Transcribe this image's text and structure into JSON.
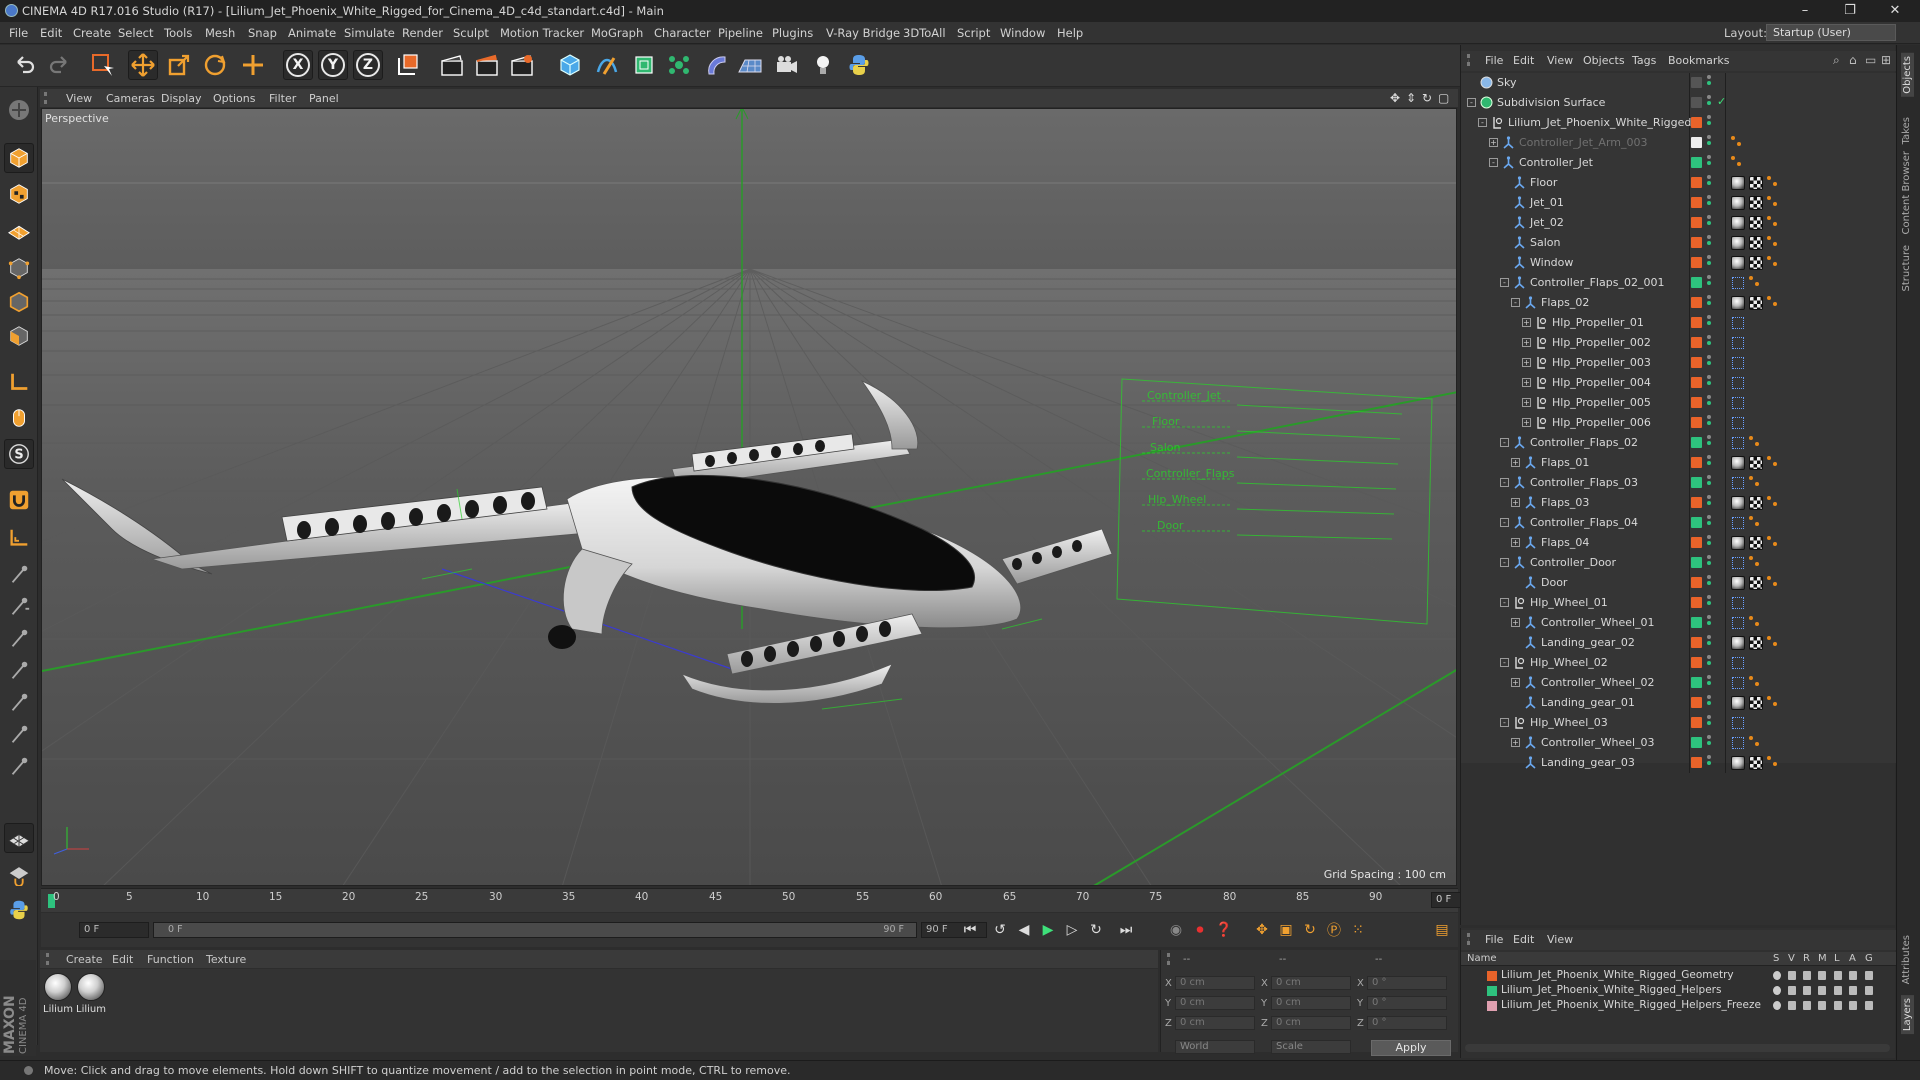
{
  "window": {
    "title": "CINEMA 4D R17.016 Studio (R17) - [Lilium_Jet_Phoenix_White_Rigged_for_Cinema_4D_c4d_standart.c4d] - Main",
    "minimize": "–",
    "restore": "❐",
    "close": "✕"
  },
  "menubar": {
    "items": [
      "File",
      "Edit",
      "Create",
      "Select",
      "Tools",
      "Mesh",
      "Snap",
      "Animate",
      "Simulate",
      "Render",
      "Sculpt",
      "Motion Tracker",
      "MoGraph",
      "Character",
      "Pipeline",
      "Plugins",
      "V-Ray Bridge",
      "3DToAll",
      "Script",
      "Window",
      "Help"
    ],
    "layout_label": "Layout:",
    "layout_value": "Startup (User)"
  },
  "toolbar": {
    "axis_x": "X",
    "axis_y": "Y",
    "axis_z": "Z"
  },
  "viewport": {
    "menu": [
      "View",
      "Cameras",
      "Display",
      "Options",
      "Filter",
      "Panel"
    ],
    "label": "Perspective",
    "grid_spacing": "Grid Spacing : 100 cm",
    "helper_lines": [
      "Controller_Jet",
      "Floor",
      "Salon",
      "Controller_Flaps",
      "Hlp_Wheel",
      "Door"
    ]
  },
  "timeline": {
    "ticks": [
      "0",
      "5",
      "10",
      "15",
      "20",
      "25",
      "30",
      "35",
      "40",
      "45",
      "50",
      "55",
      "60",
      "65",
      "70",
      "75",
      "80",
      "85",
      "90"
    ],
    "current_frame": "0 F"
  },
  "transport": {
    "start_field": "0 F",
    "range_start": "0 F",
    "range_end": "90 F",
    "end_field": "90 F"
  },
  "material_manager": {
    "menu": [
      "Create",
      "Edit",
      "Function",
      "Texture"
    ],
    "materials": [
      "Lilium",
      "Lilium"
    ]
  },
  "coordinates": {
    "header_pos": "--",
    "header_size": "--",
    "header_rot": "--",
    "rows": [
      {
        "l1": "X",
        "v1": "0 cm",
        "l2": "X",
        "v2": "0 cm",
        "l3": "X",
        "v3": "0 °"
      },
      {
        "l1": "Y",
        "v1": "0 cm",
        "l2": "Y",
        "v2": "0 cm",
        "l3": "Y",
        "v3": "0 °"
      },
      {
        "l1": "Z",
        "v1": "0 cm",
        "l2": "Z",
        "v2": "0 cm",
        "l3": "Z",
        "v3": "0 °"
      }
    ],
    "mode": "World",
    "scale": "Scale",
    "apply": "Apply"
  },
  "object_manager": {
    "menu": [
      "File",
      "Edit",
      "View",
      "Objects",
      "Tags",
      "Bookmarks"
    ],
    "objects": [
      {
        "name": "Sky",
        "depth": 0,
        "exp": "",
        "icon": "sky",
        "layer": "",
        "tags": [],
        "dim": false
      },
      {
        "name": "Subdivision Surface",
        "depth": 0,
        "exp": "-",
        "icon": "subd",
        "layer": "",
        "tags": [],
        "dim": false
      },
      {
        "name": "Lilium_Jet_Phoenix_White_Rigged",
        "depth": 1,
        "exp": "-",
        "icon": "null",
        "layer": "#e8632a",
        "tags": [],
        "dim": false
      },
      {
        "name": "Controller_Jet_Arm_003",
        "depth": 2,
        "exp": "+",
        "icon": "joint",
        "layer": "#eeeeee",
        "tags": [
          "ora"
        ],
        "dim": true
      },
      {
        "name": "Controller_Jet",
        "depth": 2,
        "exp": "-",
        "icon": "joint",
        "layer": "#2ec27e",
        "tags": [
          "ora"
        ],
        "dim": false
      },
      {
        "name": "Floor",
        "depth": 3,
        "exp": "",
        "icon": "joint",
        "layer": "#e8632a",
        "tags": [
          "mat",
          "chk",
          "ora"
        ],
        "dim": false
      },
      {
        "name": "Jet_01",
        "depth": 3,
        "exp": "",
        "icon": "joint",
        "layer": "#e8632a",
        "tags": [
          "mat",
          "chk",
          "ora"
        ],
        "dim": false
      },
      {
        "name": "Jet_02",
        "depth": 3,
        "exp": "",
        "icon": "joint",
        "layer": "#e8632a",
        "tags": [
          "mat",
          "chk",
          "ora"
        ],
        "dim": false
      },
      {
        "name": "Salon",
        "depth": 3,
        "exp": "",
        "icon": "joint",
        "layer": "#e8632a",
        "tags": [
          "mat",
          "chk",
          "ora"
        ],
        "dim": false
      },
      {
        "name": "Window",
        "depth": 3,
        "exp": "",
        "icon": "joint",
        "layer": "#e8632a",
        "tags": [
          "mat",
          "chk",
          "ora"
        ],
        "dim": false
      },
      {
        "name": "Controller_Flaps_02_001",
        "depth": 3,
        "exp": "-",
        "icon": "joint",
        "layer": "#2ec27e",
        "tags": [
          "blu",
          "ora"
        ],
        "dim": false
      },
      {
        "name": "Flaps_02",
        "depth": 4,
        "exp": "-",
        "icon": "joint",
        "layer": "#e8632a",
        "tags": [
          "mat",
          "chk",
          "ora"
        ],
        "dim": false
      },
      {
        "name": "Hlp_Propeller_01",
        "depth": 5,
        "exp": "+",
        "icon": "null",
        "layer": "#e8632a",
        "tags": [
          "blu"
        ],
        "dim": false
      },
      {
        "name": "Hlp_Propeller_002",
        "depth": 5,
        "exp": "+",
        "icon": "null",
        "layer": "#e8632a",
        "tags": [
          "blu"
        ],
        "dim": false
      },
      {
        "name": "Hlp_Propeller_003",
        "depth": 5,
        "exp": "+",
        "icon": "null",
        "layer": "#e8632a",
        "tags": [
          "blu"
        ],
        "dim": false
      },
      {
        "name": "Hlp_Propeller_004",
        "depth": 5,
        "exp": "+",
        "icon": "null",
        "layer": "#e8632a",
        "tags": [
          "blu"
        ],
        "dim": false
      },
      {
        "name": "Hlp_Propeller_005",
        "depth": 5,
        "exp": "+",
        "icon": "null",
        "layer": "#e8632a",
        "tags": [
          "blu"
        ],
        "dim": false
      },
      {
        "name": "Hlp_Propeller_006",
        "depth": 5,
        "exp": "+",
        "icon": "null",
        "layer": "#e8632a",
        "tags": [
          "blu"
        ],
        "dim": false
      },
      {
        "name": "Controller_Flaps_02",
        "depth": 3,
        "exp": "-",
        "icon": "joint",
        "layer": "#2ec27e",
        "tags": [
          "blu",
          "ora"
        ],
        "dim": false
      },
      {
        "name": "Flaps_01",
        "depth": 4,
        "exp": "+",
        "icon": "joint",
        "layer": "#e8632a",
        "tags": [
          "mat",
          "chk",
          "ora"
        ],
        "dim": false
      },
      {
        "name": "Controller_Flaps_03",
        "depth": 3,
        "exp": "-",
        "icon": "joint",
        "layer": "#2ec27e",
        "tags": [
          "blu",
          "ora"
        ],
        "dim": false
      },
      {
        "name": "Flaps_03",
        "depth": 4,
        "exp": "+",
        "icon": "joint",
        "layer": "#e8632a",
        "tags": [
          "mat",
          "chk",
          "ora"
        ],
        "dim": false
      },
      {
        "name": "Controller_Flaps_04",
        "depth": 3,
        "exp": "-",
        "icon": "joint",
        "layer": "#2ec27e",
        "tags": [
          "blu",
          "ora"
        ],
        "dim": false
      },
      {
        "name": "Flaps_04",
        "depth": 4,
        "exp": "+",
        "icon": "joint",
        "layer": "#e8632a",
        "tags": [
          "mat",
          "chk",
          "ora"
        ],
        "dim": false
      },
      {
        "name": "Controller_Door",
        "depth": 3,
        "exp": "-",
        "icon": "joint",
        "layer": "#2ec27e",
        "tags": [
          "blu",
          "ora"
        ],
        "dim": false
      },
      {
        "name": "Door",
        "depth": 4,
        "exp": "",
        "icon": "joint",
        "layer": "#e8632a",
        "tags": [
          "mat",
          "chk",
          "ora"
        ],
        "dim": false
      },
      {
        "name": "Hlp_Wheel_01",
        "depth": 3,
        "exp": "-",
        "icon": "null",
        "layer": "#e8632a",
        "tags": [
          "blu"
        ],
        "dim": false
      },
      {
        "name": "Controller_Wheel_01",
        "depth": 4,
        "exp": "+",
        "icon": "joint",
        "layer": "#2ec27e",
        "tags": [
          "blu",
          "ora"
        ],
        "dim": false
      },
      {
        "name": "Landing_gear_02",
        "depth": 4,
        "exp": "",
        "icon": "joint",
        "layer": "#e8632a",
        "tags": [
          "mat",
          "chk",
          "ora"
        ],
        "dim": false
      },
      {
        "name": "Hlp_Wheel_02",
        "depth": 3,
        "exp": "-",
        "icon": "null",
        "layer": "#e8632a",
        "tags": [
          "blu"
        ],
        "dim": false
      },
      {
        "name": "Controller_Wheel_02",
        "depth": 4,
        "exp": "+",
        "icon": "joint",
        "layer": "#2ec27e",
        "tags": [
          "blu",
          "ora"
        ],
        "dim": false
      },
      {
        "name": "Landing_gear_01",
        "depth": 4,
        "exp": "",
        "icon": "joint",
        "layer": "#e8632a",
        "tags": [
          "mat",
          "chk",
          "ora"
        ],
        "dim": false
      },
      {
        "name": "Hlp_Wheel_03",
        "depth": 3,
        "exp": "-",
        "icon": "null",
        "layer": "#e8632a",
        "tags": [
          "blu"
        ],
        "dim": false
      },
      {
        "name": "Controller_Wheel_03",
        "depth": 4,
        "exp": "+",
        "icon": "joint",
        "layer": "#2ec27e",
        "tags": [
          "blu",
          "ora"
        ],
        "dim": false
      },
      {
        "name": "Landing_gear_03",
        "depth": 4,
        "exp": "",
        "icon": "joint",
        "layer": "#e8632a",
        "tags": [
          "mat",
          "chk",
          "ora"
        ],
        "dim": false
      }
    ]
  },
  "layer_manager": {
    "menu": [
      "File",
      "Edit",
      "View"
    ],
    "headers": {
      "name": "Name",
      "s": "S",
      "v": "V",
      "r": "R",
      "m": "M",
      "l": "L",
      "a": "A",
      "g": "G"
    },
    "layers": [
      {
        "name": "Lilium_Jet_Phoenix_White_Rigged_Geometry",
        "color": "#e8632a"
      },
      {
        "name": "Lilium_Jet_Phoenix_White_Rigged_Helpers",
        "color": "#2ec27e"
      },
      {
        "name": "Lilium_Jet_Phoenix_White_Rigged_Helpers_Freeze",
        "color": "#e0a0b0"
      }
    ]
  },
  "right_tabs": [
    "Objects",
    "Takes",
    "Content Browser",
    "Structure"
  ],
  "right_tabs_lower": [
    "Attributes",
    "Layers"
  ],
  "branding": {
    "maxon": "MAXON",
    "cinema": "CINEMA 4D"
  },
  "status": "Move: Click and drag to move elements. Hold down SHIFT to quantize movement / add to the selection in point mode, CTRL to remove.",
  "colors": {
    "accent": "#e88a1a",
    "helper_green": "#2ec27e",
    "layer_orange": "#e8632a",
    "grid_green": "#2a9a2a"
  }
}
